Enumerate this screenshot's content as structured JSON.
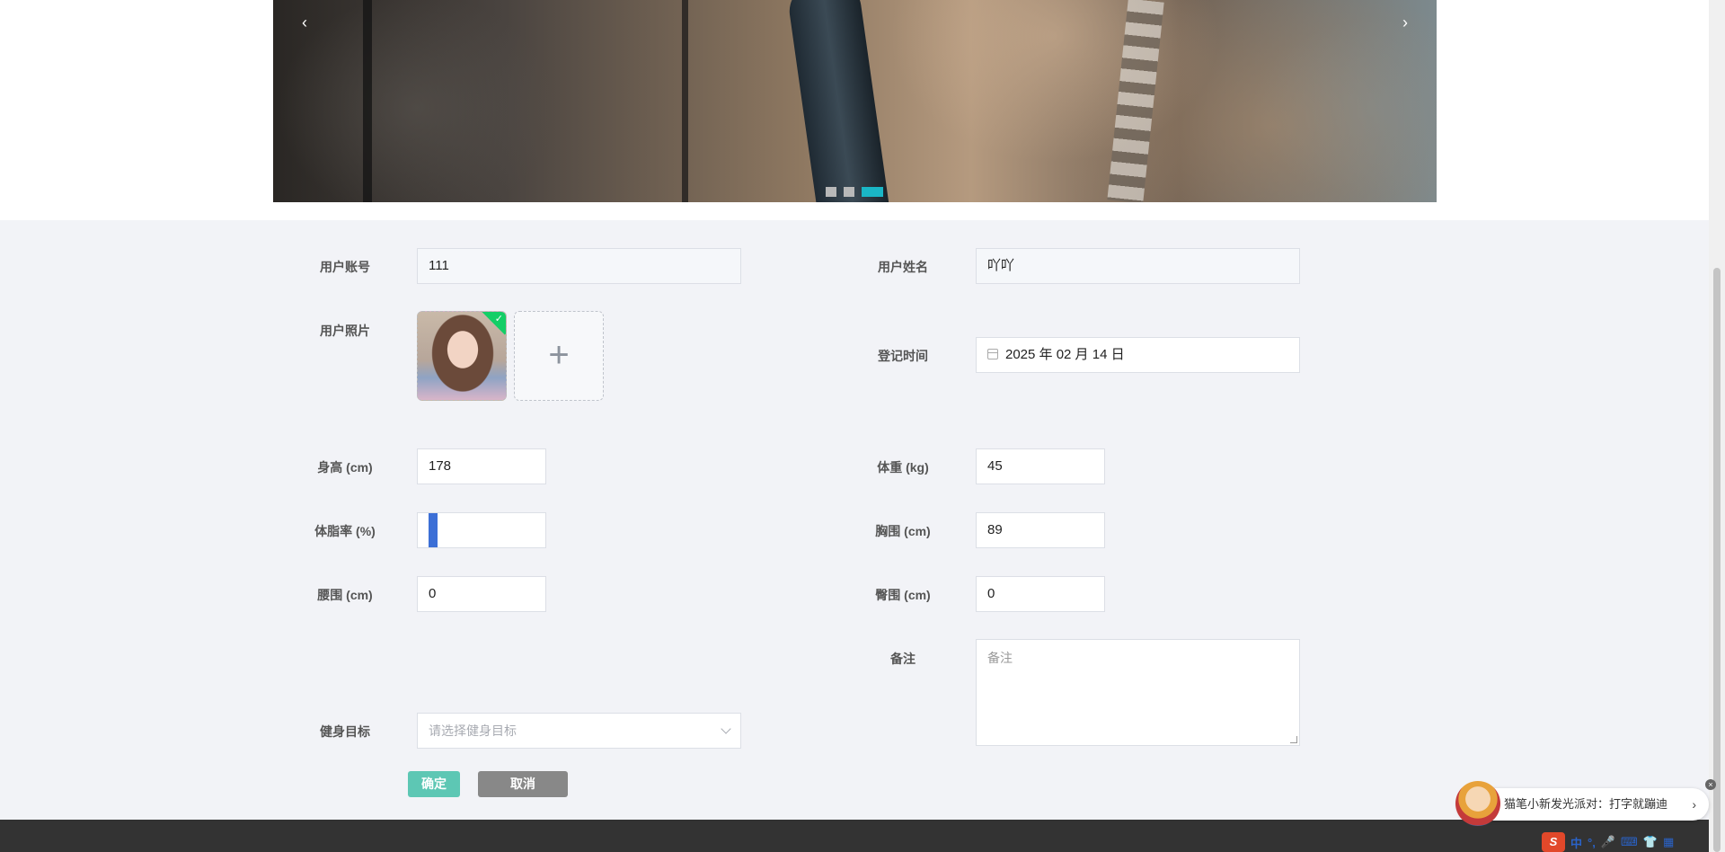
{
  "carousel": {
    "prev": "‹",
    "next": "›",
    "slide_count": 3,
    "active_slide": 3
  },
  "form": {
    "account": {
      "label": "用户账号",
      "value": "111"
    },
    "name": {
      "label": "用户姓名",
      "value": "吖吖"
    },
    "photo": {
      "label": "用户照片",
      "add": "+"
    },
    "reg_time": {
      "label": "登记时间",
      "value": "2025 年 02 月 14 日"
    },
    "height": {
      "label": "身高 (cm)",
      "value": "178"
    },
    "weight": {
      "label": "体重 (kg)",
      "value": "45"
    },
    "body_fat": {
      "label": "体脂率 (%)",
      "value": ""
    },
    "chest": {
      "label": "胸围 (cm)",
      "value": "89"
    },
    "waist": {
      "label": "腰围 (cm)",
      "value": "0"
    },
    "hip": {
      "label": "臀围 (cm)",
      "value": "0"
    },
    "remark": {
      "label": "备注",
      "placeholder": "备注"
    },
    "goal": {
      "label": "健身目标",
      "placeholder": "请选择健身目标"
    },
    "confirm": "确定",
    "cancel": "取消"
  },
  "toast": {
    "text": "猫笔小新发光派对：打字就蹦迪",
    "arrow": "›",
    "close": "×"
  },
  "ime": {
    "logo": "S",
    "mode": "中",
    "punct": "°,"
  },
  "colors": {
    "accent": "#1ab6c6",
    "confirm": "#5dc7b4",
    "cancel": "#888888",
    "footer": "#333333",
    "upload_success": "#13ce66"
  }
}
